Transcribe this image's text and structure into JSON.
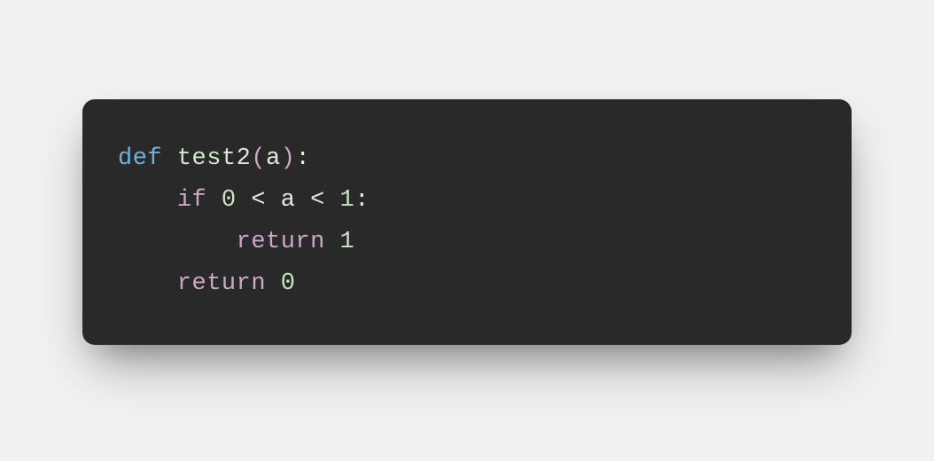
{
  "code": {
    "language": "python",
    "tokens": {
      "def": "def",
      "fn_name": "test2",
      "open_paren": "(",
      "param": "a",
      "close_paren": ")",
      "colon": ":",
      "if_kw": "if",
      "num_0a": "0",
      "lt1": "<",
      "var_a": "a",
      "lt2": "<",
      "num_1a": "1",
      "colon2": ":",
      "return1": "return",
      "num_1b": "1",
      "return2": "return",
      "num_0b": "0"
    }
  }
}
